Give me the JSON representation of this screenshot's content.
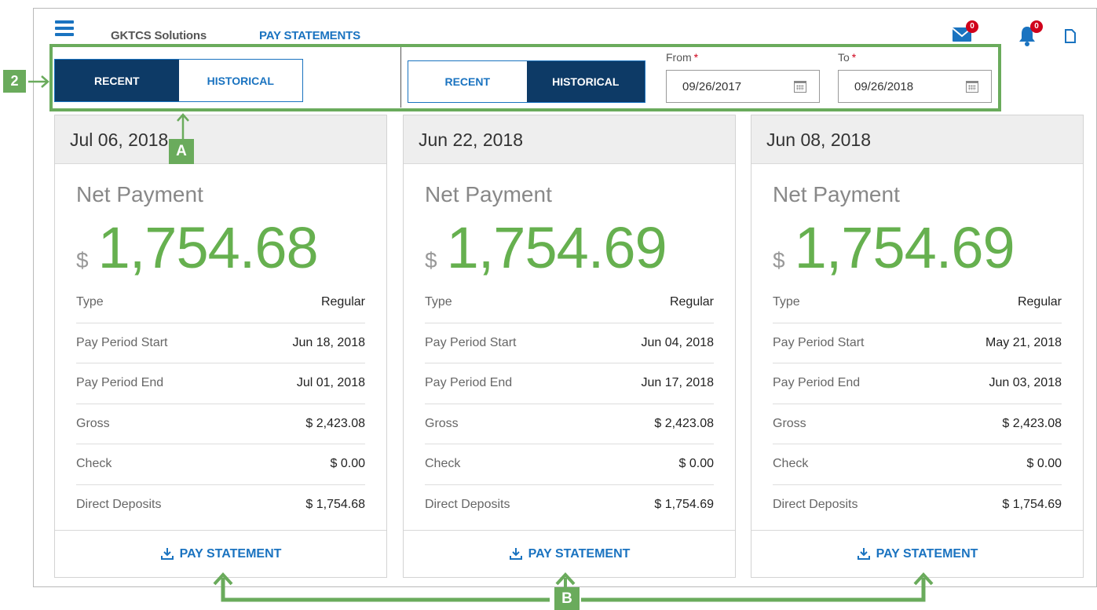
{
  "header": {
    "company": "GKTCS Solutions",
    "page_title": "PAY STATEMENTS",
    "mail_badge": "0",
    "bell_badge": "0"
  },
  "annotations": {
    "number": "2",
    "letter_a": "A",
    "letter_b": "B",
    "color": "#6aab5c"
  },
  "toggle_left": {
    "recent": "RECENT",
    "historical": "HISTORICAL",
    "active": "recent"
  },
  "toggle_right": {
    "recent": "RECENT",
    "historical": "HISTORICAL",
    "active": "historical"
  },
  "date_range": {
    "from_label": "From",
    "to_label": "To",
    "required_mark": "*",
    "from_value": "09/26/2017",
    "to_value": "09/26/2018"
  },
  "cards": [
    {
      "date": "Jul 06, 2018",
      "net_label": "Net Payment",
      "currency": "$",
      "amount": "1,754.68",
      "rows": [
        {
          "k": "Type",
          "v": "Regular"
        },
        {
          "k": "Pay Period Start",
          "v": "Jun 18, 2018"
        },
        {
          "k": "Pay Period End",
          "v": "Jul 01, 2018"
        },
        {
          "k": "Gross",
          "v": "$ 2,423.08"
        },
        {
          "k": "Check",
          "v": "$ 0.00"
        },
        {
          "k": "Direct Deposits",
          "v": "$ 1,754.68"
        }
      ],
      "action": "PAY STATEMENT"
    },
    {
      "date": "Jun 22, 2018",
      "net_label": "Net Payment",
      "currency": "$",
      "amount": "1,754.69",
      "rows": [
        {
          "k": "Type",
          "v": "Regular"
        },
        {
          "k": "Pay Period Start",
          "v": "Jun 04, 2018"
        },
        {
          "k": "Pay Period End",
          "v": "Jun 17, 2018"
        },
        {
          "k": "Gross",
          "v": "$ 2,423.08"
        },
        {
          "k": "Check",
          "v": "$ 0.00"
        },
        {
          "k": "Direct Deposits",
          "v": "$ 1,754.69"
        }
      ],
      "action": "PAY STATEMENT"
    },
    {
      "date": "Jun 08, 2018",
      "net_label": "Net Payment",
      "currency": "$",
      "amount": "1,754.69",
      "rows": [
        {
          "k": "Type",
          "v": "Regular"
        },
        {
          "k": "Pay Period Start",
          "v": "May 21, 2018"
        },
        {
          "k": "Pay Period End",
          "v": "Jun 03, 2018"
        },
        {
          "k": "Gross",
          "v": "$ 2,423.08"
        },
        {
          "k": "Check",
          "v": "$ 0.00"
        },
        {
          "k": "Direct Deposits",
          "v": "$ 1,754.69"
        }
      ],
      "action": "PAY STATEMENT"
    }
  ],
  "icons": [
    "menu-icon",
    "mail-icon",
    "bell-icon",
    "document-icon",
    "calendar-icon",
    "download-icon"
  ]
}
